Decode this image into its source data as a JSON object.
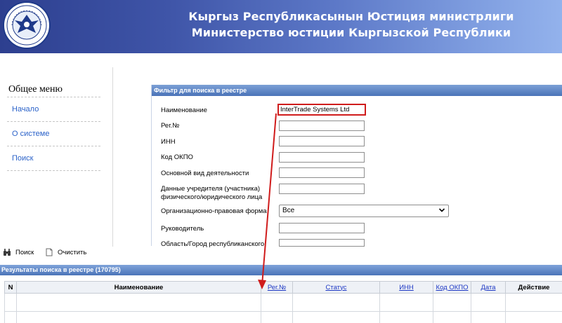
{
  "header": {
    "title_kg": "Кыргыз Республикасынын Юстиция министрлиги",
    "title_ru": "Министерство юстиции Кыргызской Республики",
    "logo_icon": "ministry-emblem-icon"
  },
  "sidebar": {
    "heading": "Общее меню",
    "items": [
      {
        "label": "Начало"
      },
      {
        "label": "О системе"
      },
      {
        "label": "Поиск"
      }
    ]
  },
  "filter": {
    "panel_title": "Фильтр для поиска в реестре",
    "fields": [
      {
        "label": "Наименование",
        "value": "InterTrade Systems Ltd"
      },
      {
        "label": "Рег.№",
        "value": ""
      },
      {
        "label": "ИНН",
        "value": ""
      },
      {
        "label": "Код ОКПО",
        "value": ""
      },
      {
        "label": "Основной вид деятельности",
        "value": ""
      },
      {
        "label": "Данные учредителя (участника) физического/юридического лица",
        "value": ""
      },
      {
        "label": "Организационно-правовая форма",
        "value": "Все"
      },
      {
        "label": "Руководитель",
        "value": ""
      },
      {
        "label": "Область/Город республиканского",
        "value": ""
      }
    ]
  },
  "toolbar": {
    "search_label": "Поиск",
    "clear_label": "Очистить",
    "search_icon": "binoculars-icon",
    "clear_icon": "document-icon"
  },
  "results": {
    "title": "Результаты поиска в реестре (170795)",
    "columns": [
      "N",
      "Наименование",
      "Рег.№",
      "Статус",
      "ИНН",
      "Код ОКПО",
      "Дата",
      "Действие"
    ]
  },
  "colors": {
    "header_dark": "#2d3f8f",
    "header_light": "#93b2ec",
    "panel_bar": "#4a73b8",
    "link": "#2c63c9",
    "annotation": "#d01c1c"
  }
}
